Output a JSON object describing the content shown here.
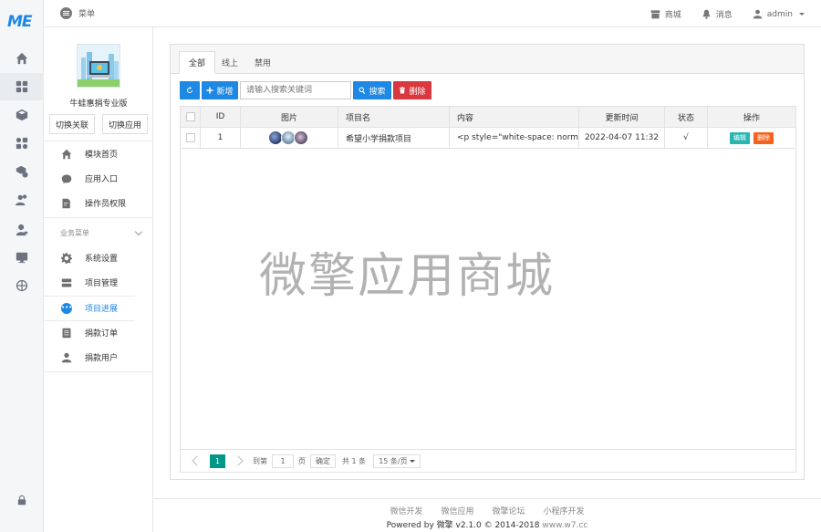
{
  "brand": {
    "logo_text": "ME",
    "color": "#1e88e5"
  },
  "topbar": {
    "menu_label": "菜单",
    "store_label": "商城",
    "messages_label": "消息",
    "user_label": "admin"
  },
  "rail": {
    "icons": [
      "home-icon",
      "apps-grid-icon",
      "cube-icon",
      "modules-icon",
      "box-gear-icon",
      "users-icon",
      "user-key-icon",
      "monitor-icon",
      "globe-icon"
    ],
    "bottom_icon": "lock-icon"
  },
  "app": {
    "name": "牛蛙惠捐专业版",
    "switch_link_label": "切换关联",
    "switch_app_label": "切换应用"
  },
  "sidebar": {
    "items_top": [
      {
        "label": "模块首页",
        "icon": "home-icon"
      },
      {
        "label": "应用入口",
        "icon": "chat-icon"
      },
      {
        "label": "操作员权限",
        "icon": "document-edit-icon"
      }
    ],
    "group_label": "业务菜单",
    "items_business": [
      {
        "label": "系统设置",
        "icon": "gear-icon"
      },
      {
        "label": "项目管理",
        "icon": "server-icon"
      },
      {
        "label": "项目进展",
        "icon": "more-dots-icon",
        "active": true
      },
      {
        "label": "捐款订单",
        "icon": "list-icon"
      },
      {
        "label": "捐款用户",
        "icon": "user-icon"
      }
    ]
  },
  "tabs": [
    {
      "label": "全部",
      "active": true
    },
    {
      "label": "线上"
    },
    {
      "label": "禁用"
    }
  ],
  "toolbar": {
    "refresh_icon": "refresh-icon",
    "add_label": "新增",
    "search_placeholder": "请输入搜索关键词",
    "search_label": "搜索",
    "delete_label": "删除"
  },
  "table": {
    "headers": [
      "",
      "ID",
      "图片",
      "项目名",
      "内容",
      "更新时间",
      "状态",
      "操作"
    ],
    "rows": [
      {
        "id": "1",
        "name": "希望小学捐款项目",
        "content": "<p style=\"white-space: normal;...",
        "updated": "2022-04-07 11:32",
        "status": "√",
        "edit_label": "编辑",
        "delete_label": "删除"
      }
    ]
  },
  "watermark": "微擎应用商城",
  "pager": {
    "current_page": "1",
    "goto_prefix": "到第",
    "goto_value": "1",
    "goto_suffix": "页",
    "confirm_label": "确定",
    "total_label": "共 1 条",
    "per_page_label": "15 条/页"
  },
  "footer": {
    "links": [
      "微信开发",
      "微信应用",
      "微擎论坛",
      "小程序开发"
    ],
    "powered": "Powered by 微擎 v2.1.0 © 2014-2018",
    "url": "www.w7.cc"
  }
}
